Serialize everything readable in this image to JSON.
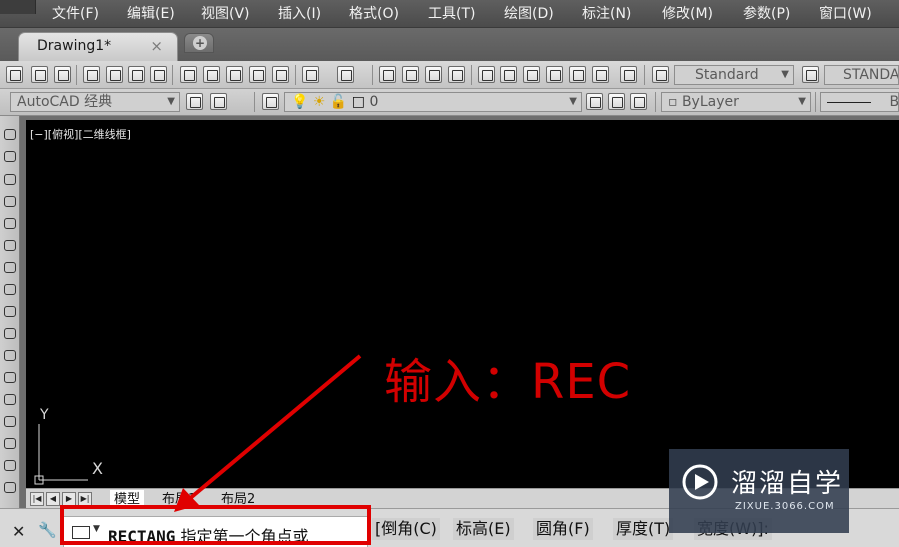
{
  "menu": {
    "items": [
      "文件(F)",
      "编辑(E)",
      "视图(V)",
      "插入(I)",
      "格式(O)",
      "工具(T)",
      "绘图(D)",
      "标注(N)",
      "修改(M)",
      "参数(P)",
      "窗口(W)"
    ]
  },
  "tabs": {
    "document": "Drawing1*",
    "close_glyph": "×"
  },
  "toolbar": {
    "text_style": "Standard",
    "dim_style": "STANDA",
    "workspace": "AutoCAD 经典",
    "layer": "0",
    "color": "ByLayer",
    "linetype": "By"
  },
  "canvas": {
    "view_label": "[−][俯视][二维线框]",
    "annotation": "输入：REC",
    "ucs_y": "Y",
    "ucs_x": "X"
  },
  "layout_tabs": [
    "模型",
    "布局1",
    "布局2"
  ],
  "command": {
    "name": "RECTANG",
    "prompt": "指定第一个角点或",
    "options": [
      "[倒角(C)",
      "标高(E)",
      "圆角(F)",
      "厚度(T)",
      "宽度(W)]:"
    ]
  },
  "watermark": {
    "title": "溜溜自学",
    "subtitle": "ZIXUE.3066.COM"
  },
  "colors": {
    "annotation": "#d20000",
    "highlight": "#e00000",
    "canvas": "#000000"
  }
}
